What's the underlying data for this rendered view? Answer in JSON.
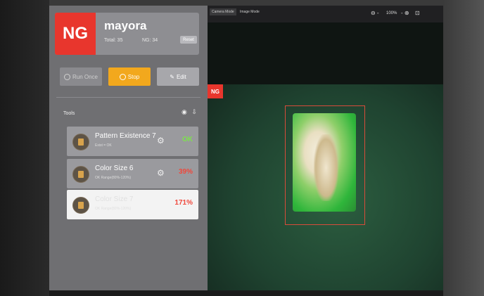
{
  "header": {
    "status_badge": "NG",
    "title": "mayora",
    "total_label": "Total: 35",
    "ng_label": "NG: 34",
    "reset_label": "Reset"
  },
  "controls": {
    "run_once": "Run Once",
    "stop": "Stop",
    "edit": "Edit"
  },
  "tools": {
    "section_label": "Tools",
    "items": [
      {
        "name": "Pattern Existence 7",
        "sub": "Exist = OK",
        "result": "OK",
        "result_color": "#7de04d",
        "card_color": "#9a9a9e"
      },
      {
        "name": "Color Size 6",
        "sub": "OK Range(80%-120%)",
        "result": "39%",
        "result_color": "#f0483c",
        "card_color": "#9a9a9e"
      },
      {
        "name": "Color Size 7",
        "sub": "OK Range(80%-120%)",
        "result": "171%",
        "result_color": "#f0483c",
        "card_color": "#f3f3f3"
      }
    ]
  },
  "viewer": {
    "tab_camera": "Camera Mode",
    "tab_image": "Image Mode",
    "zoom_level": "100%",
    "ng_tag": "NG"
  },
  "colors": {
    "ng_red": "#e8362d",
    "stop_orange": "#f2a81d",
    "ok_green": "#7de04d"
  }
}
